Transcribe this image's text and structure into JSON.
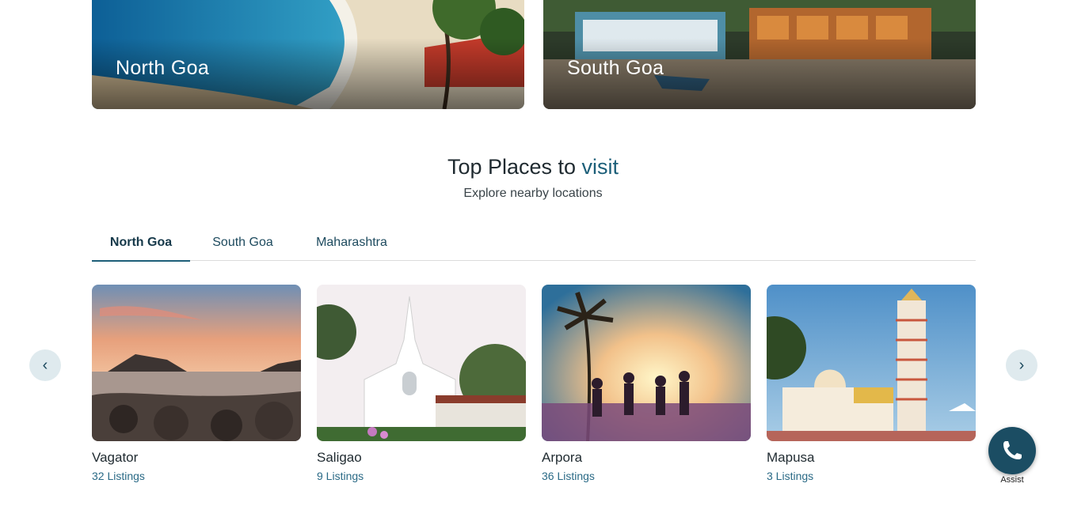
{
  "regions": [
    {
      "label": "North Goa",
      "image": "beach-photo"
    },
    {
      "label": "South Goa",
      "image": "beach-huts-photo"
    }
  ],
  "section": {
    "title_main": "Top Places to ",
    "title_accent": "visit",
    "subtitle": "Explore nearby locations"
  },
  "tabs": [
    {
      "label": "North Goa",
      "active": true
    },
    {
      "label": "South Goa",
      "active": false
    },
    {
      "label": "Maharashtra",
      "active": false
    }
  ],
  "places": [
    {
      "name": "Vagator",
      "listings": "32 Listings",
      "image": "rocky-shore-sunset-photo"
    },
    {
      "name": "Saligao",
      "listings": "9 Listings",
      "image": "white-church-photo"
    },
    {
      "name": "Arpora",
      "listings": "36 Listings",
      "image": "party-palm-sunset-photo"
    },
    {
      "name": "Mapusa",
      "listings": "3 Listings",
      "image": "temple-tower-photo"
    }
  ],
  "nav": {
    "prev_icon": "chevron-left-icon",
    "prev_glyph": "‹",
    "next_icon": "chevron-right-icon",
    "next_glyph": "›"
  },
  "assist": {
    "label": "Assist",
    "icon": "phone-icon"
  },
  "colors": {
    "accent": "#1d5f79",
    "assist_bg": "#1b4d63",
    "arrow_bg": "#dfeaee"
  }
}
